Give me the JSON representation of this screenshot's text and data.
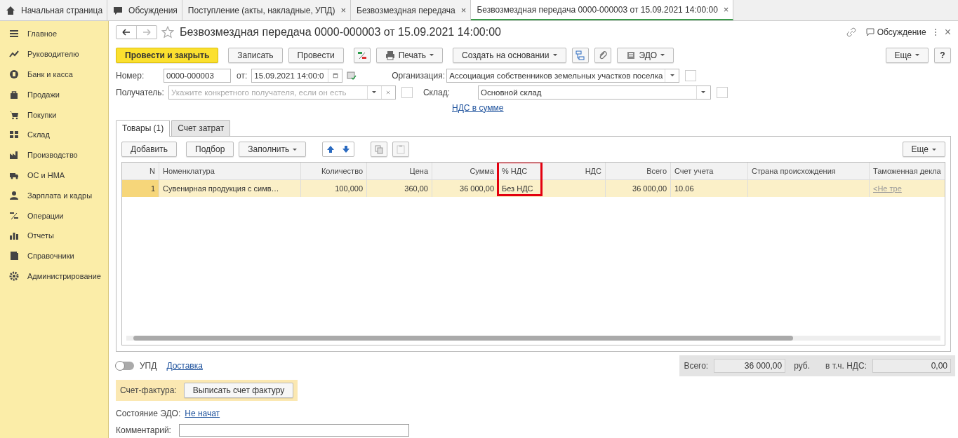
{
  "top_tabs": [
    {
      "label": "Начальная страница",
      "kind": "home",
      "selected": false,
      "closable": false
    },
    {
      "label": "Обсуждения",
      "kind": "chat",
      "selected": false,
      "closable": false
    },
    {
      "label": "Поступление (акты, накладные, УПД)",
      "kind": "doc",
      "selected": false,
      "closable": true
    },
    {
      "label": "Безвозмездная передача",
      "kind": "doc",
      "selected": false,
      "closable": true
    },
    {
      "label": "Безвозмездная передача 0000-000003 от 15.09.2021 14:00:00",
      "kind": "doc",
      "selected": true,
      "closable": true
    }
  ],
  "close_glyph": "×",
  "sidebar": {
    "items": [
      {
        "label": "Главное"
      },
      {
        "label": "Руководителю"
      },
      {
        "label": "Банк и касса"
      },
      {
        "label": "Продажи"
      },
      {
        "label": "Покупки"
      },
      {
        "label": "Склад"
      },
      {
        "label": "Производство"
      },
      {
        "label": "ОС и НМА"
      },
      {
        "label": "Зарплата и кадры"
      },
      {
        "label": "Операции"
      },
      {
        "label": "Отчеты"
      },
      {
        "label": "Справочники"
      },
      {
        "label": "Администрирование"
      }
    ]
  },
  "header": {
    "title": "Безвозмездная передача 0000-000003 от 15.09.2021 14:00:00",
    "discussion": "Обсуждение",
    "close": "×"
  },
  "toolbar": {
    "buttons": [
      {
        "label": "Провести и закрыть",
        "kind": "primary"
      },
      {
        "label": "Записать",
        "kind": "plain"
      },
      {
        "label": "Провести",
        "kind": "plain"
      },
      {
        "kind": "dtkt"
      },
      {
        "label": "Печать",
        "kind": "print"
      },
      {
        "label": "Создать на основании",
        "kind": "menu"
      },
      {
        "kind": "structure"
      },
      {
        "kind": "clip"
      },
      {
        "label": "ЭДО",
        "kind": "edo"
      }
    ],
    "more": "Еще",
    "help": "?"
  },
  "form": {
    "number_label": "Номер:",
    "number": "0000-000003",
    "date_label": "от:",
    "date": "15.09.2021 14:00:0",
    "recipient_label": "Получатель:",
    "recipient_placeholder": "Укажите конкретного получателя, если он есть",
    "org_label": "Организация:",
    "org": "Ассоциация собственников земельных участков поселка",
    "warehouse_label": "Склад:",
    "warehouse": "Основной склад",
    "vat_link": "НДС в сумме"
  },
  "inner_tabs": [
    {
      "label": "Товары (1)",
      "selected": true
    },
    {
      "label": "Счет затрат",
      "selected": false
    }
  ],
  "table_toolbar": {
    "add": "Добавить",
    "pick": "Подбор",
    "fill": "Заполнить",
    "more": "Еще"
  },
  "table": {
    "columns": [
      {
        "label": "N",
        "highlighted": false
      },
      {
        "label": "Номенклатура",
        "highlighted": false
      },
      {
        "label": "Количество",
        "highlighted": false
      },
      {
        "label": "Цена",
        "highlighted": false
      },
      {
        "label": "Сумма",
        "highlighted": false
      },
      {
        "label": "% НДС",
        "highlighted": true
      },
      {
        "label": "НДС",
        "highlighted": false
      },
      {
        "label": "Всего",
        "highlighted": false
      },
      {
        "label": "Счет учета",
        "highlighted": false
      },
      {
        "label": "Страна происхождения",
        "highlighted": false
      },
      {
        "label": "Таможенная декла",
        "highlighted": false
      }
    ],
    "rows": [
      {
        "selected": true,
        "cells": [
          "1",
          "Сувенирная продукция с симв…",
          "100,000",
          "360,00",
          "36 000,00",
          "Без НДС",
          "",
          "36 000,00",
          "10.06",
          "",
          "<Не тре"
        ]
      }
    ]
  },
  "footer": {
    "upd_on": false,
    "upd_label": "УПД",
    "delivery_link": "Доставка",
    "total_label": "Всего:",
    "total": "36 000,00",
    "currency": "руб.",
    "vat_label": "в т.ч. НДС:",
    "vat": "0,00",
    "invoice_label": "Счет-фактура:",
    "invoice_button": "Выписать счет фактуру",
    "edo_label": "Состояние ЭДО:",
    "edo_link": "Не начат",
    "comment_label": "Комментарий:"
  }
}
